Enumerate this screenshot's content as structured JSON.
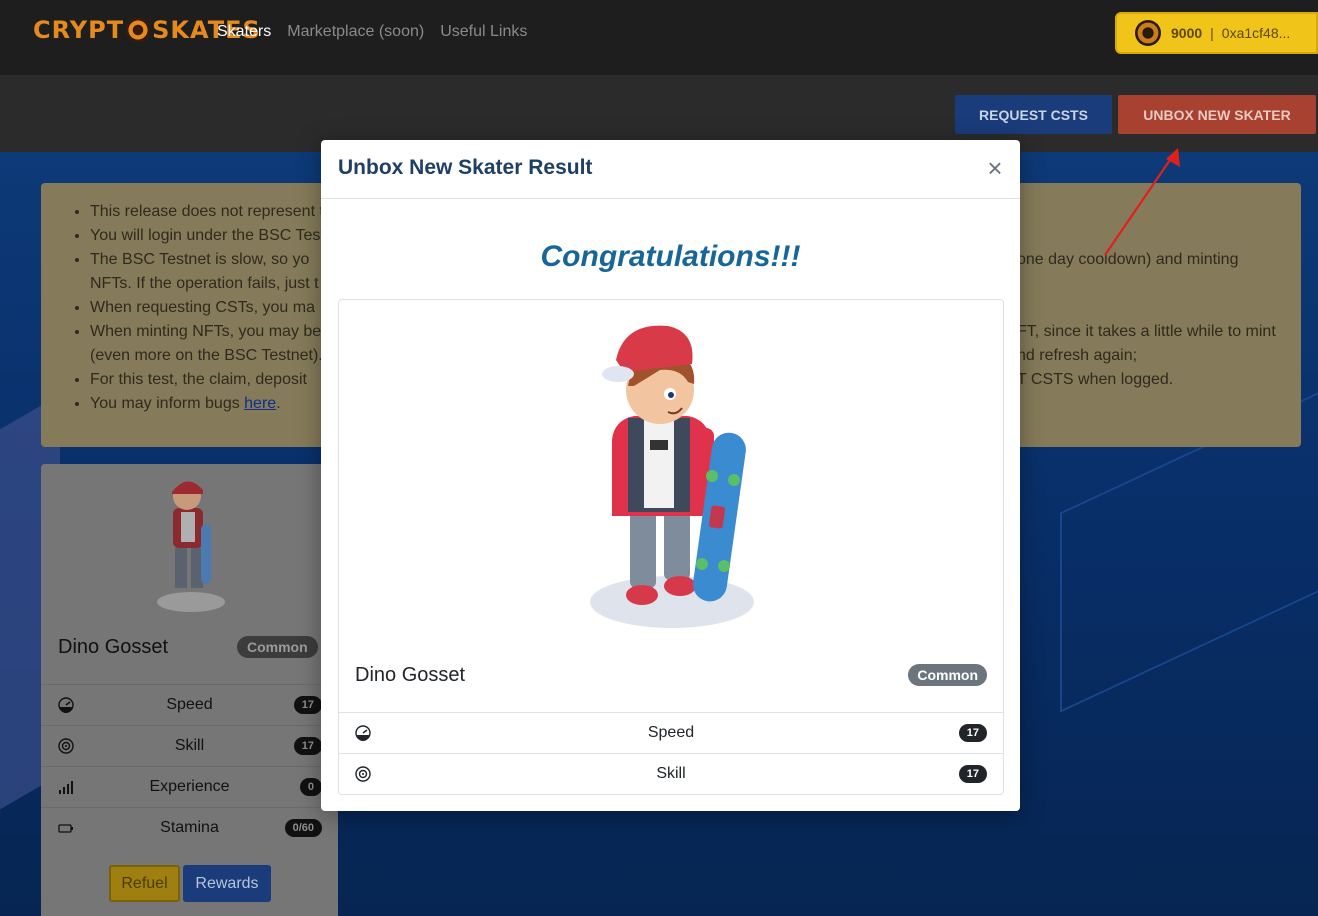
{
  "nav": {
    "brand_left": "CRYPT",
    "brand_right": "SKATES",
    "links": [
      "Skaters",
      "Marketplace (soon)",
      "Useful Links"
    ],
    "wallet_balance": "9000",
    "wallet_separator": "|",
    "wallet_address": "0xa1cf48..."
  },
  "toolbar": {
    "request_label": "REQUEST CSTS",
    "unbox_label": "UNBOX NEW SKATER"
  },
  "notice": {
    "items": [
      "This release does not represent t",
      "You will login under the BSC Test",
      "The BSC Testnet is slow, so yo",
      "NFTs. If the operation fails, just t",
      "When requesting CSTs, you ma",
      "When minting NFTs, you may be",
      "(even more on the BSC Testnet).",
      "For this test, the claim, deposit",
      "You may inform bugs here."
    ],
    "right_fragments": [
      "one day cooldown) and minting",
      "FT, since it takes a little while to mint",
      "nd refresh again;",
      "T CSTS when logged."
    ],
    "link_text": "here"
  },
  "card": {
    "name": "Dino Gosset",
    "rarity": "Common",
    "stats": [
      {
        "label": "Speed",
        "value": "17",
        "icon": "speedometer-icon"
      },
      {
        "label": "Skill",
        "value": "17",
        "icon": "target-icon"
      },
      {
        "label": "Experience",
        "value": "0",
        "icon": "bars-icon"
      },
      {
        "label": "Stamina",
        "value": "0/60",
        "icon": "battery-icon"
      }
    ],
    "refuel_label": "Refuel",
    "rewards_label": "Rewards"
  },
  "modal": {
    "title": "Unbox New Skater Result",
    "close": "×",
    "congrats": "Congratulations!!!",
    "name": "Dino Gosset",
    "rarity": "Common",
    "stats": [
      {
        "label": "Speed",
        "value": "17",
        "icon": "speedometer-icon"
      },
      {
        "label": "Skill",
        "value": "17",
        "icon": "target-icon"
      }
    ]
  },
  "colors": {
    "accent_red": "#d9534f",
    "primary_blue": "#1e4fa3",
    "wallet_yellow": "#f0c419",
    "title_blue": "#1e3f66",
    "congrats_blue": "#17669a"
  }
}
